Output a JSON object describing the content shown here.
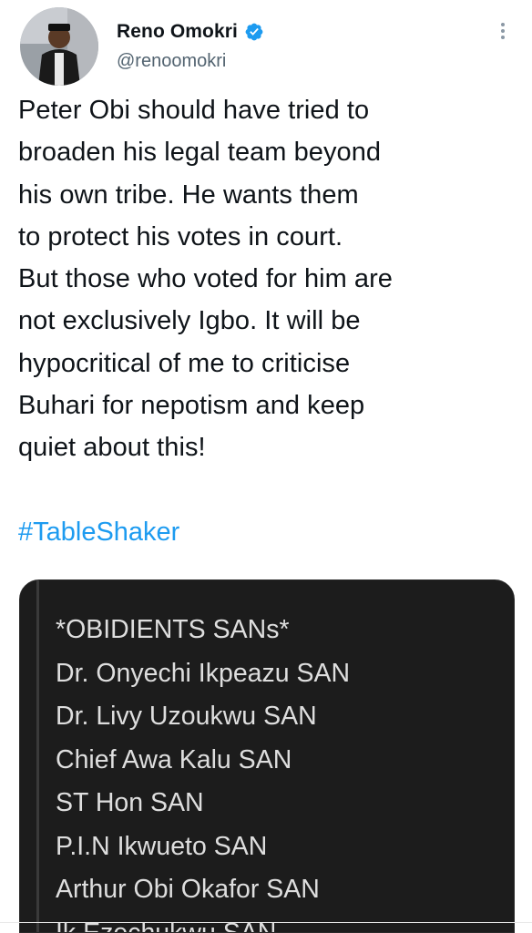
{
  "author": {
    "display_name": "Reno Omokri",
    "handle": "@renoomokri",
    "verified": true,
    "avatar_icon": "profile-photo",
    "verified_color": "#1d9bf0"
  },
  "menu": {
    "more_icon": "vertical-ellipsis-icon"
  },
  "tweet": {
    "text_lines": [
      "Peter Obi should have tried to",
      "broaden his legal team beyond",
      "his own tribe. He wants them",
      "to protect his votes in court.",
      "But those who voted for him are",
      "not exclusively Igbo. It will be",
      "hypocritical of me to criticise",
      "Buhari for nepotism and keep",
      "quiet about this!"
    ],
    "hashtag": "#TableShaker",
    "hashtag_color": "#1d9bf0"
  },
  "media": {
    "lines": [
      "*OBIDIENTS SANs*",
      "Dr. Onyechi Ikpeazu SAN",
      "Dr. Livy Uzoukwu SAN",
      "Chief Awa Kalu SAN",
      "ST Hon SAN",
      "P.I.N Ikwueto SAN",
      "Arthur Obi Okafor SAN",
      "Ik Ezechukwu SAN"
    ],
    "background": "#1c1c1c"
  }
}
